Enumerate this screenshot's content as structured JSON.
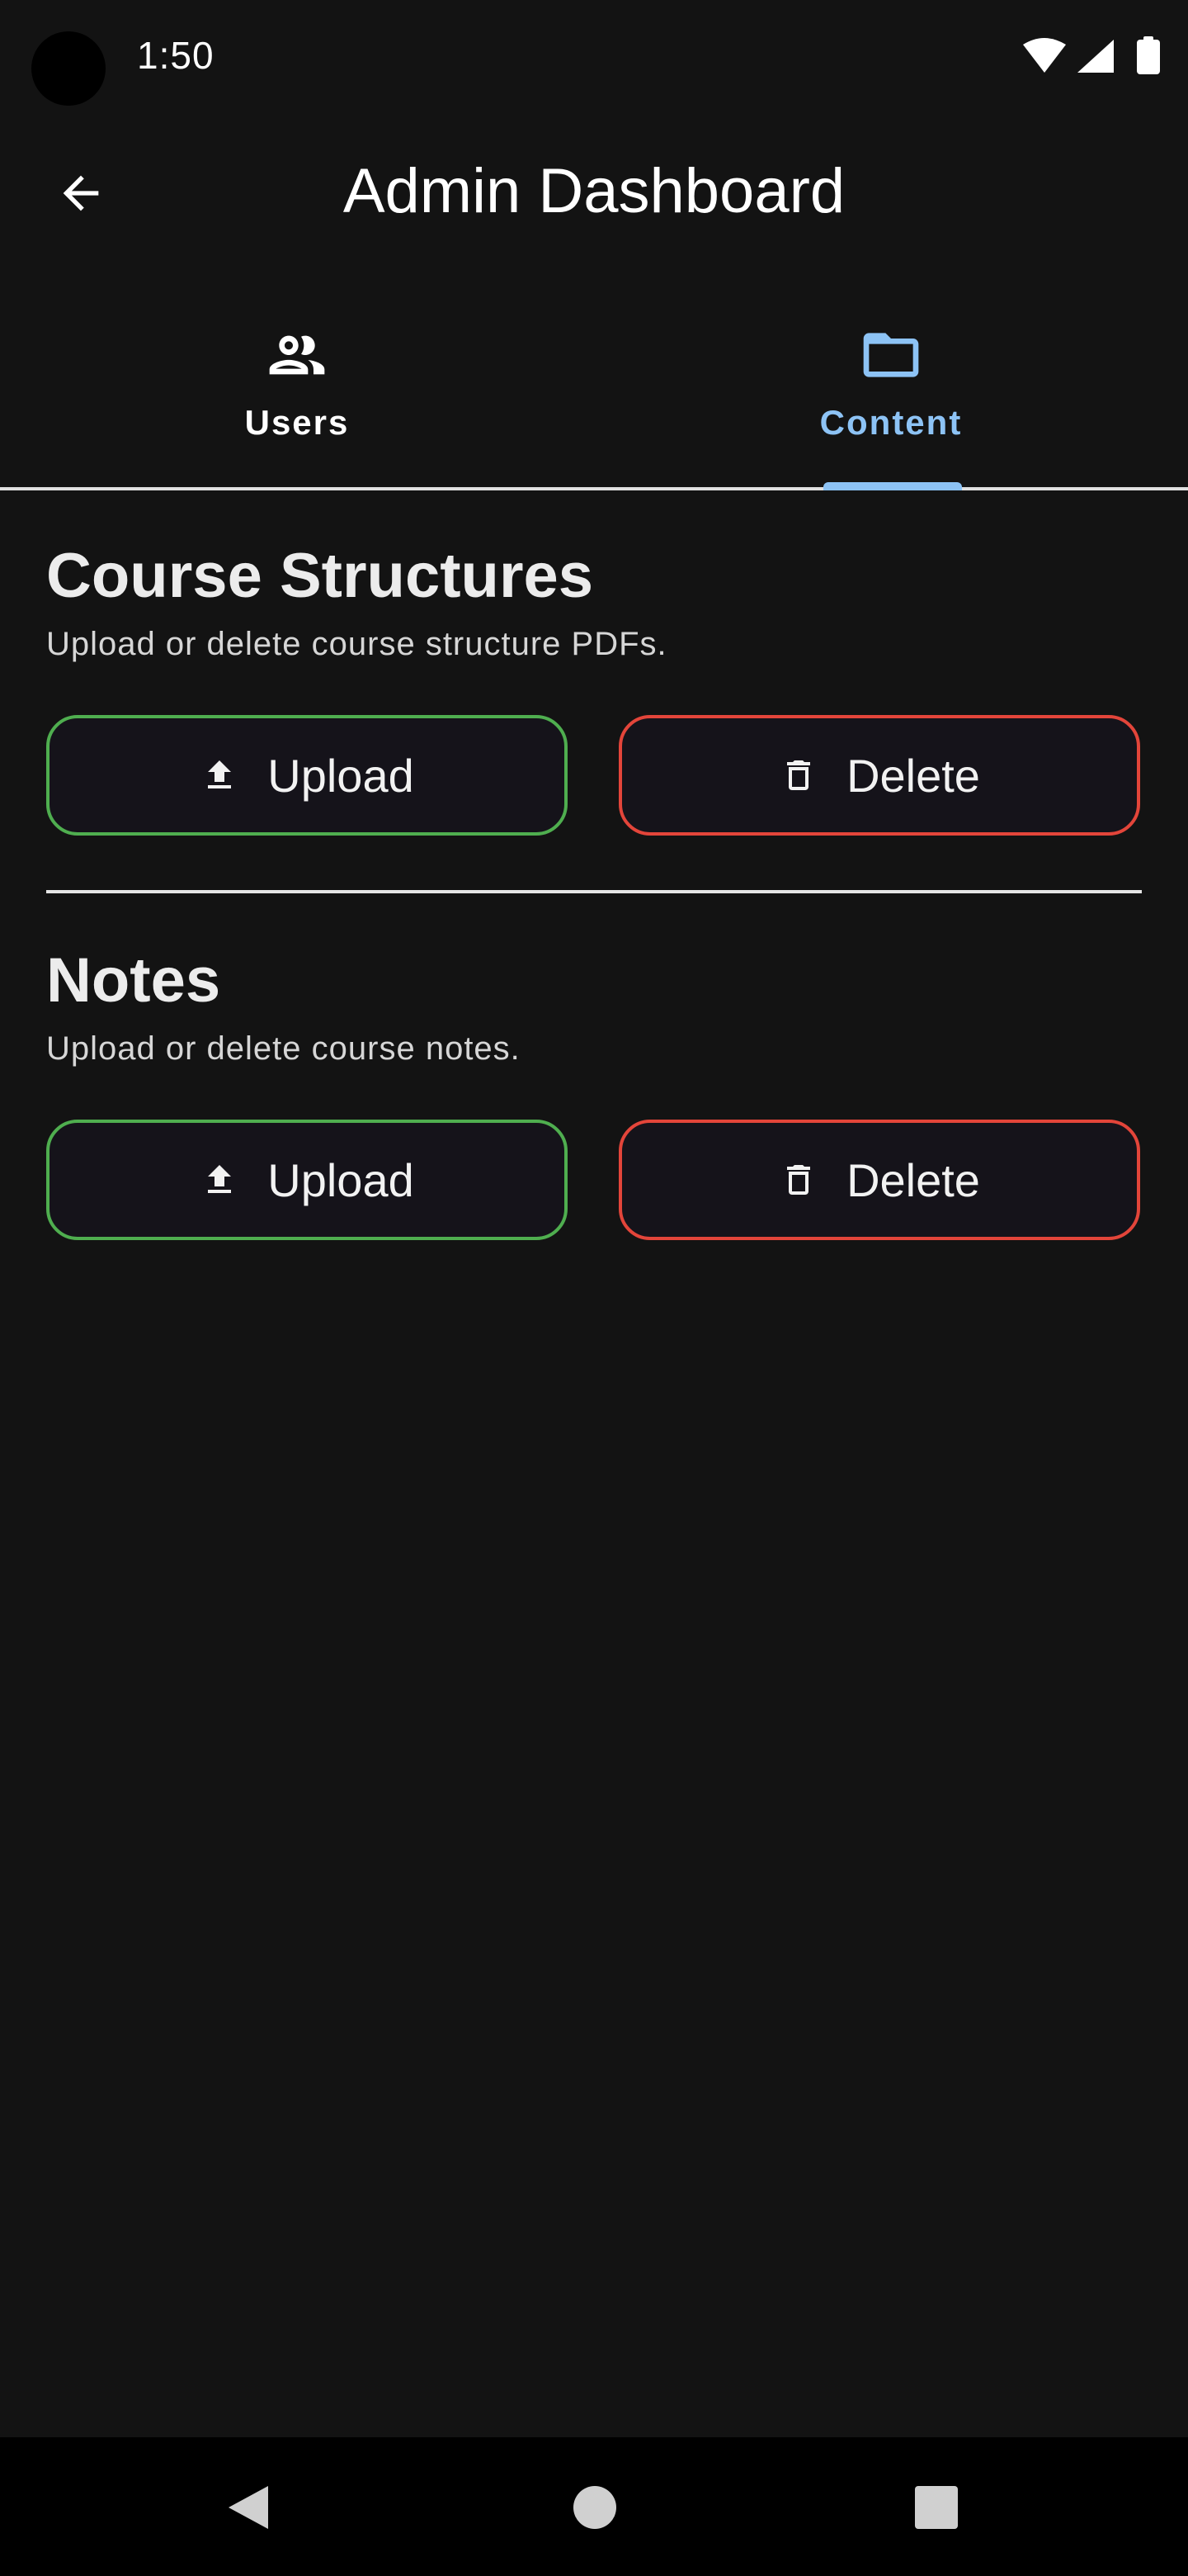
{
  "status_bar": {
    "time": "1:50",
    "icons": [
      "wifi-icon",
      "cellular-signal-icon",
      "battery-icon"
    ]
  },
  "app_bar": {
    "title": "Admin Dashboard",
    "back_icon": "arrow-back-icon"
  },
  "tabs": [
    {
      "label": "Users",
      "icon": "people-icon",
      "selected": false
    },
    {
      "label": "Content",
      "icon": "folder-icon",
      "selected": true
    }
  ],
  "sections": [
    {
      "title": "Course Structures",
      "description": "Upload or delete course structure PDFs.",
      "upload_label": "Upload",
      "delete_label": "Delete"
    },
    {
      "title": "Notes",
      "description": "Upload or delete course notes.",
      "upload_label": "Upload",
      "delete_label": "Delete"
    }
  ],
  "nav_bar": {
    "buttons": [
      "back-triangle-icon",
      "home-circle-icon",
      "recents-square-icon"
    ]
  },
  "colors": {
    "background": "#131313",
    "accent_tab": "#8dc3f5",
    "upload_border": "#4fae4f",
    "delete_border": "#e3453a"
  }
}
